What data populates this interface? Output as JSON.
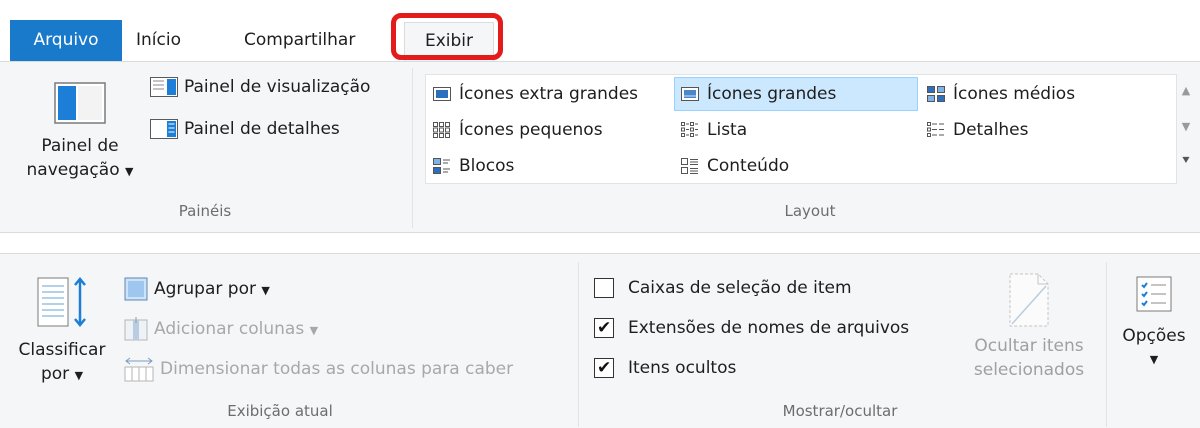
{
  "tabs": {
    "file": "Arquivo",
    "home": "Início",
    "share": "Compartilhar",
    "view": "Exibir"
  },
  "panes": {
    "nav_label_line1": "Painel de",
    "nav_label_line2": "navegação",
    "preview_pane": "Painel de visualização",
    "details_pane": "Painel de detalhes",
    "group_label": "Painéis"
  },
  "layout": {
    "items": [
      "Ícones extra grandes",
      "Ícones grandes",
      "Ícones médios",
      "Ícones pequenos",
      "Lista",
      "Detalhes",
      "Blocos",
      "Conteúdo"
    ],
    "selected": "Ícones grandes",
    "group_label": "Layout"
  },
  "current_view": {
    "sort_line1": "Classificar",
    "sort_line2": "por",
    "group_by": "Agrupar por",
    "add_columns": "Adicionar colunas",
    "size_columns": "Dimensionar todas as colunas para caber",
    "group_label": "Exibição atual"
  },
  "show_hide": {
    "item_checkboxes": "Caixas de seleção de item",
    "item_checkboxes_checked": false,
    "file_extensions": "Extensões de nomes de arquivos",
    "file_extensions_checked": true,
    "hidden_items": "Itens ocultos",
    "hidden_items_checked": true,
    "hide_selected_line1": "Ocultar itens",
    "hide_selected_line2": "selecionados",
    "group_label": "Mostrar/ocultar"
  },
  "options": {
    "label": "Opções"
  },
  "colors": {
    "file_tab": "#1979ca",
    "highlight": "#e31b1b",
    "selected_item": "#cce8ff"
  }
}
